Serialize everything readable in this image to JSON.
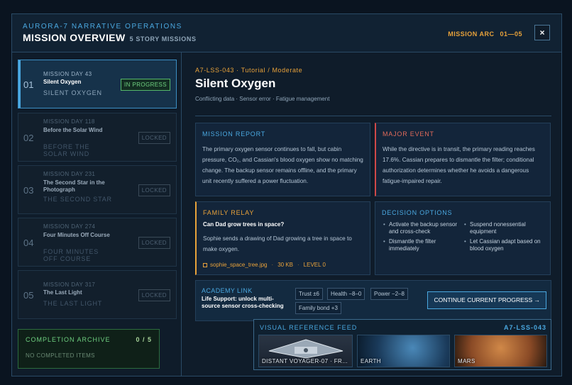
{
  "header": {
    "subtitle": "AURORA-7 NARRATIVE OPERATIONS",
    "title": "MISSION OVERVIEW",
    "count": "5 STORY MISSIONS",
    "arc_label": "MISSION ARC",
    "arc_range": "01—05",
    "close_label": "×"
  },
  "missions": [
    {
      "num": "01",
      "day": "MISSION DAY 43",
      "name": "Silent Oxygen",
      "sub": "SILENT OXYGEN",
      "status": "IN PROGRESS"
    },
    {
      "num": "02",
      "day": "MISSION DAY 118",
      "name": "Before the Solar Wind",
      "sub": "BEFORE THE SOLAR WIND",
      "status": "LOCKED"
    },
    {
      "num": "03",
      "day": "MISSION DAY 231",
      "name": "The Second Star in the Photograph",
      "sub": "THE SECOND STAR",
      "status": "LOCKED"
    },
    {
      "num": "04",
      "day": "MISSION DAY 274",
      "name": "Four Minutes Off Course",
      "sub": "FOUR MINUTES OFF COURSE",
      "status": "LOCKED"
    },
    {
      "num": "05",
      "day": "MISSION DAY 317",
      "name": "The Last Light",
      "sub": "THE LAST LIGHT",
      "status": "LOCKED"
    }
  ],
  "archive": {
    "title": "COMPLETION ARCHIVE",
    "count": "0 / 5",
    "note": "NO COMPLETED ITEMS"
  },
  "detail": {
    "code": "A7-LSS-043 · Tutorial / Moderate",
    "title": "Silent Oxygen",
    "tags": "Conflicting data · Sensor error · Fatigue management"
  },
  "report": {
    "title": "MISSION REPORT",
    "text": "The primary oxygen sensor continues to fall, but cabin pressure, CO₂, and Cassian's blood oxygen show no matching change. The backup sensor remains offline, and the primary unit recently suffered a power fluctuation."
  },
  "event": {
    "title": "MAJOR EVENT",
    "text": "While the directive is in transit, the primary reading reaches 17.6%. Cassian prepares to dismantle the filter; conditional authorization determines whether he avoids a dangerous fatigue-impaired repair."
  },
  "relay": {
    "title": "FAMILY RELAY",
    "question": "Can Dad grow trees in space?",
    "text": "Sophie sends a drawing of Dad growing a tree in space to make oxygen.",
    "file": "sophie_space_tree.jpg",
    "size": "30 KB",
    "level": "LEVEL 0"
  },
  "options": {
    "title": "DECISION OPTIONS",
    "items": [
      "Activate the backup sensor and cross-check",
      "Suspend nonessential equipment",
      "Dismantle the filter immediately",
      "Let Cassian adapt based on blood oxygen"
    ]
  },
  "academy": {
    "title": "ACADEMY LINK",
    "text": "Life Support: unlock multi-source sensor cross-checking",
    "chips": [
      "Trust ±6",
      "Health −8–0",
      "Power −2–8",
      "Family bond +3"
    ],
    "button": "CONTINUE CURRENT PROGRESS →"
  },
  "feed": {
    "title": "VISUAL REFERENCE FEED",
    "code": "A7-LSS-043",
    "items": [
      "DISTANT VOYAGER-07 · FR...",
      "EARTH",
      "MARS"
    ]
  },
  "colors": {
    "accent": "#4aa8e0",
    "warning": "#e8a23a",
    "danger": "#d04848",
    "success": "#6fd080"
  }
}
